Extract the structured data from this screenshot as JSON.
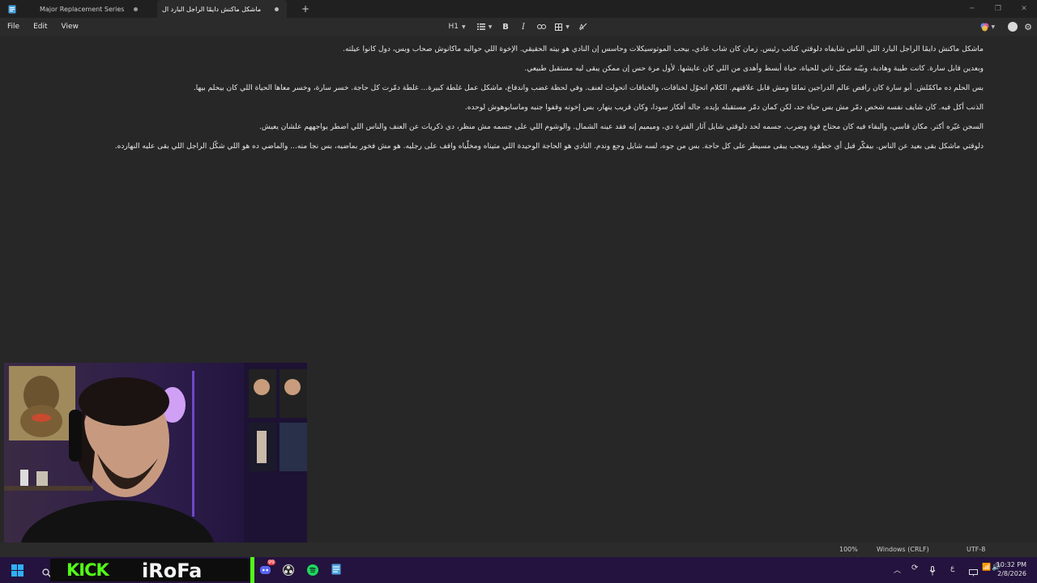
{
  "tabs": [
    {
      "title": "Major Replacement Series",
      "active": false
    },
    {
      "title": "ماشكل ماكنش دايمًا الراجل البارد ال",
      "active": true
    }
  ],
  "menu": {
    "file": "File",
    "edit": "Edit",
    "view": "View"
  },
  "toolbar": {
    "heading": "H1"
  },
  "document": {
    "lines": [
      "ماشكل ماكنش دايمًا الراجل البارد اللي الناس شايفاه دلوقتي كنائب رئيس. زمان كان شاب عادي، بيحب الموتوسيكلات وحاسس إن النادي هو بيته الحقيقي. الإخوة اللي حواليه ماكانوش صحاب وبس، دول كانوا عيلته.",
      "وبعدين قابل سارة. كانت طيبة وهادية، وبيّنه شكل تاني للحياة، حياة أبسط وأهدى من اللي كان عايشها. لأول مرة حس إن ممكن يبقى ليه مستقبل طبيعي.",
      "بس الحلم ده ماكمّلش. أبو سارة كان رافض عالم الدراجين تمامًا ومش قابل علاقتهم. الكلام اتحوّل لخناقات، والخناقات اتحولت لعنف. وفي لحظة غضب واندفاع، ماشكل عمل غلطة كبيرة... غلطة دمّرت كل حاجة. خسر سارة، وخسر معاها الحياة اللي كان بيحلم بيها.",
      "الذنب أكل فيه. كان شايف نفسه شخص دمّر مش بس حياة حد، لكن كمان دمّر مستقبله بإيده. جاله أفكار سودا، وكان قريب ينهار، بس إخوته وقفوا جنبه وماسابوهوش لوحده.",
      "السجن غيّره أكتر. مكان قاسي، والبقاء فيه كان محتاج قوة وضرب. جسمه لحد دلوقتي شايل آثار الفترة دي، وميميم إنه فقد عينه الشمال. والوشوم اللي على جسمه مش منظر، دي ذكريات عن العنف والناس اللي اضطر يواجههم علشان يعيش.",
      "دلوقتي ماشكل بقى بعيد عن الناس. بيفكّر قبل أي خطوة، وبيحب يبقى مسيطر على كل حاجة. بس من جوه، لسه شايل وجع وندم. النادي هو الحاجة الوحيدة اللي متيناه ومخلّياه واقف على رجليه. هو مش فخور بماضيه، بس نجا منه... والماضي ده هو اللي شكّل الراجل اللي بقى عليه النهارده."
    ]
  },
  "status": {
    "zoom": "100%",
    "line_ending": "Windows (CRLF)",
    "encoding": "UTF-8"
  },
  "overlay": {
    "kick": "KICK",
    "name": "iRoFa"
  },
  "tray": {
    "lang": "ع",
    "time": "10:32 PM",
    "date": "2/8/2026",
    "badge": "99"
  }
}
